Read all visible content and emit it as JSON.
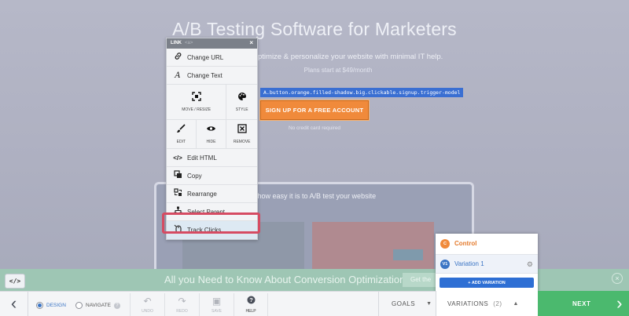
{
  "hero": {
    "title": "A/B Testing Software for Marketers",
    "subtitle": "ptimize & personalize your website with minimal IT help.",
    "price": "Plans start at $49/month",
    "selector_tag": "A.button.orange.filled-shadow.big.clickable.signup.trigger-model",
    "cta": "SIGN UP FOR A FREE ACCOUNT",
    "no_cc": "No credit card required",
    "video_caption": "h how easy it is to A/B test your website"
  },
  "announce": {
    "text": "All you Need to Know About Conversion Optimization",
    "button": "Get the",
    "close": "×"
  },
  "code_toggle": "</>",
  "context_menu": {
    "header": "LINK",
    "header_sub": "&lt;a&gt;",
    "close": "×",
    "items": {
      "change_url": "Change URL",
      "change_text": "Change Text",
      "move_resize": "MOVE / RESIZE",
      "style": "STYLE",
      "edit": "EDIT",
      "hide": "HIDE",
      "remove": "REMOVE",
      "edit_html": "Edit HTML",
      "copy": "Copy",
      "rearrange": "Rearrange",
      "select_parent": "Select Parent",
      "track_clicks": "Track Clicks"
    }
  },
  "variations_panel": {
    "control_badge": "C",
    "control": "Control",
    "v1_badge": "V1",
    "v1": "Variation 1",
    "add": "+ ADD VARIATION"
  },
  "toolbar": {
    "design": "DESIGN",
    "navigate": "NAVIGATE",
    "help_mark": "?",
    "undo": "UNDO",
    "redo": "REDO",
    "save": "SAVE",
    "help": "HELP",
    "goals": "GOALS",
    "variations": "VARIATIONS",
    "variations_count": "(2)",
    "next": "NEXT"
  },
  "colors": {
    "accent_blue": "#2e6fd4",
    "cta_orange": "#f08a3b",
    "next_green": "#4bb96e",
    "highlight_red": "#d64b62"
  }
}
